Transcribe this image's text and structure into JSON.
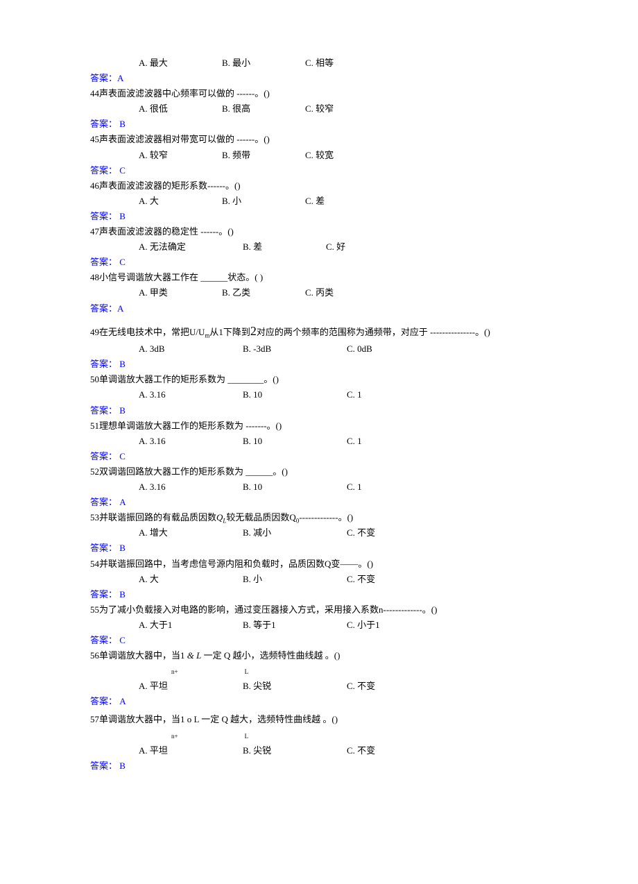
{
  "top_options": {
    "a": "A. 最大",
    "b": "B. 最小",
    "c": "C. 相等"
  },
  "top_answer": "答案：A",
  "questions": [
    {
      "num": "44",
      "text": "声表面波滤波器中心频率可以做的 ------。()",
      "a": "A. 很低",
      "b": "B. 很高",
      "c": "C. 较窄",
      "answer": "答案：  B"
    },
    {
      "num": "45",
      "text": "声表面波滤波器相对带宽可以做的 ------。()",
      "a": "A. 较窄",
      "b": "B. 频带",
      "c": "C. 较宽",
      "answer": "答案：  C"
    },
    {
      "num": "46",
      "text": "声表面波滤波器的矩形系数------。()",
      "a": "A. 大",
      "b": "B.  小",
      "c": "C. 差",
      "answer": "答案：  B"
    },
    {
      "num": "47",
      "text": "声表面波滤波器的稳定性  ------。()",
      "a": "A. 无法确定",
      "b": "B. 差",
      "c": "C. 好",
      "answer": "答案：  C"
    },
    {
      "num": "48",
      "text": "小信号调谐放大器工作在 ______状态。( )",
      "a": "A. 甲类",
      "b": "B. 乙类",
      "c": "C. 丙类",
      "answer": "答案：A"
    }
  ],
  "q49": {
    "num": "49",
    "pre": "在无线电技术中，常把U/U",
    "sub": "m",
    "mid": "从1下降到",
    "two": "2",
    "post": "对应的两个频率的范围称为通频带，对应于 ---------------。()",
    "a": "A.   3dB",
    "b": "B.   -3dB",
    "c": "C.   0dB",
    "answer": "答案：  B"
  },
  "questions2": [
    {
      "num": "50",
      "text": "单调谐放大器工作的矩形系数为 ________。()",
      "a": "A.   3.16",
      "b": "B.   10",
      "c": "C.   1",
      "answer": "答案：  B"
    },
    {
      "num": "51",
      "text": "理想单调谐放大器工作的矩形系数为 -------。()",
      "a": "A.   3.16",
      "b": "B.   10",
      "c": "C.   1",
      "answer": "答案：  C"
    },
    {
      "num": "52",
      "text": "双调谐回路放大器工作的矩形系数为 ______。()",
      "a": "A.   3.16",
      "b": "B.   10",
      "c": "C.   1",
      "answer": "答案：  A"
    }
  ],
  "q53": {
    "num": "53",
    "pre": "并联谐振回路的有载品质因数",
    "ql": "Q",
    "ql_sub": "L",
    "mid": "较无载品质因数Q",
    "q0_sub": "0",
    "post": "-------------。()",
    "a": "A. 增大",
    "b": "B. 减小",
    "c": "C. 不变",
    "answer": "答案：  B"
  },
  "questions3": [
    {
      "num": "54",
      "text": "并联谐振回路中，当考虑信号源内阻和负载时，品质因数Q变——。()",
      "a": "A. 大",
      "b": "B.  小",
      "c": "C. 不变",
      "answer": "答案：  B"
    },
    {
      "num": "55",
      "text": "为了减小负载接入对电路的影响，通过变压器接入方式，采用接入系数n-------------。()",
      "a": "A. 大于1",
      "b": "B. 等于1",
      "c": "C. 小于1",
      "answer": "答案：  C"
    }
  ],
  "q56": {
    "num": "56",
    "text1": " 单调谐放大器中，",
    "text2": "当1 ",
    "amp": "& ",
    "L": "L",
    "text3": " 一定    Q",
    "text4": " 越小，",
    "sub1": "n+",
    "sub2": "L",
    "text5": "选频特性曲线越          。()",
    "a": "A. 平坦",
    "b": "B. 尖锐",
    "c": "C. 不变",
    "answer": "答案：  A"
  },
  "q57": {
    "num": "57",
    "text1": " 单调谐放大器中，",
    "text2": "当1 o L 一定    Q",
    "text4": " 越大，",
    "sub1": "n+",
    "sub2": "L",
    "text5": "选频特性曲线越          。()",
    "a": "A. 平坦",
    "b": "B. 尖锐",
    "c": "C. 不变",
    "answer": "答案：  B"
  }
}
